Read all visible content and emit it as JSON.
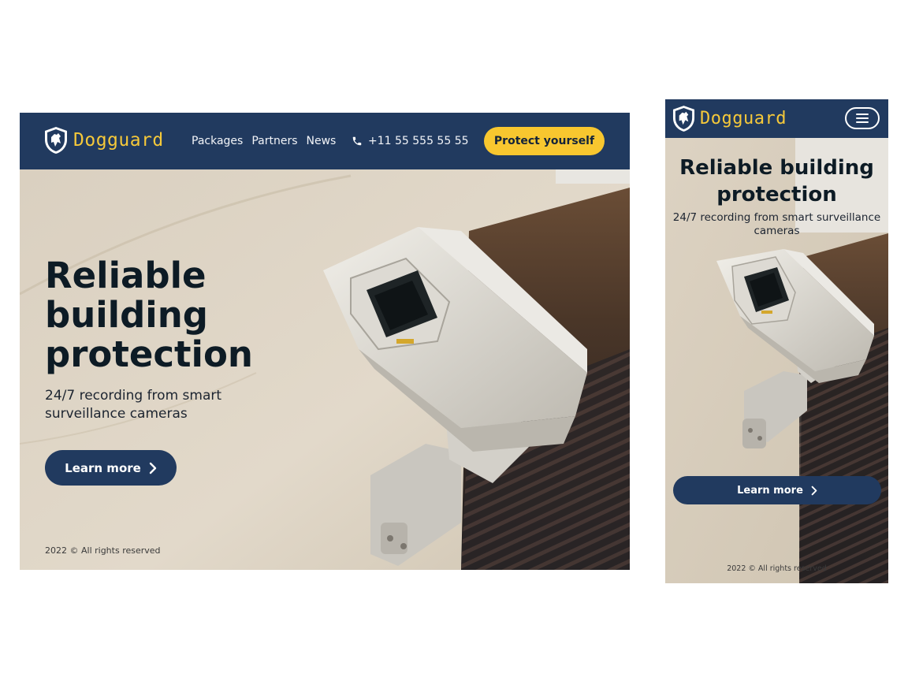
{
  "brand": {
    "name": "Dogguard",
    "logo_icon": "dog-shield-icon",
    "colors": {
      "navy": "#213a5f",
      "accent_yellow": "#f8c72f",
      "logo_yellow": "#f6c93a"
    }
  },
  "nav": {
    "links": [
      "Packages",
      "Partners",
      "News"
    ],
    "phone_icon": "phone-icon",
    "phone": "+11 55 555 55 55",
    "cta_label": "Protect yourself",
    "menu_icon": "hamburger-menu-icon"
  },
  "hero": {
    "title": "Reliable building protection",
    "subtitle": "24/7 recording from smart surveillance cameras",
    "button_label": "Learn more",
    "button_icon": "chevron-right-icon",
    "image_subject": "surveillance-camera-image"
  },
  "footer": {
    "text": "2022 © All rights reserved"
  }
}
